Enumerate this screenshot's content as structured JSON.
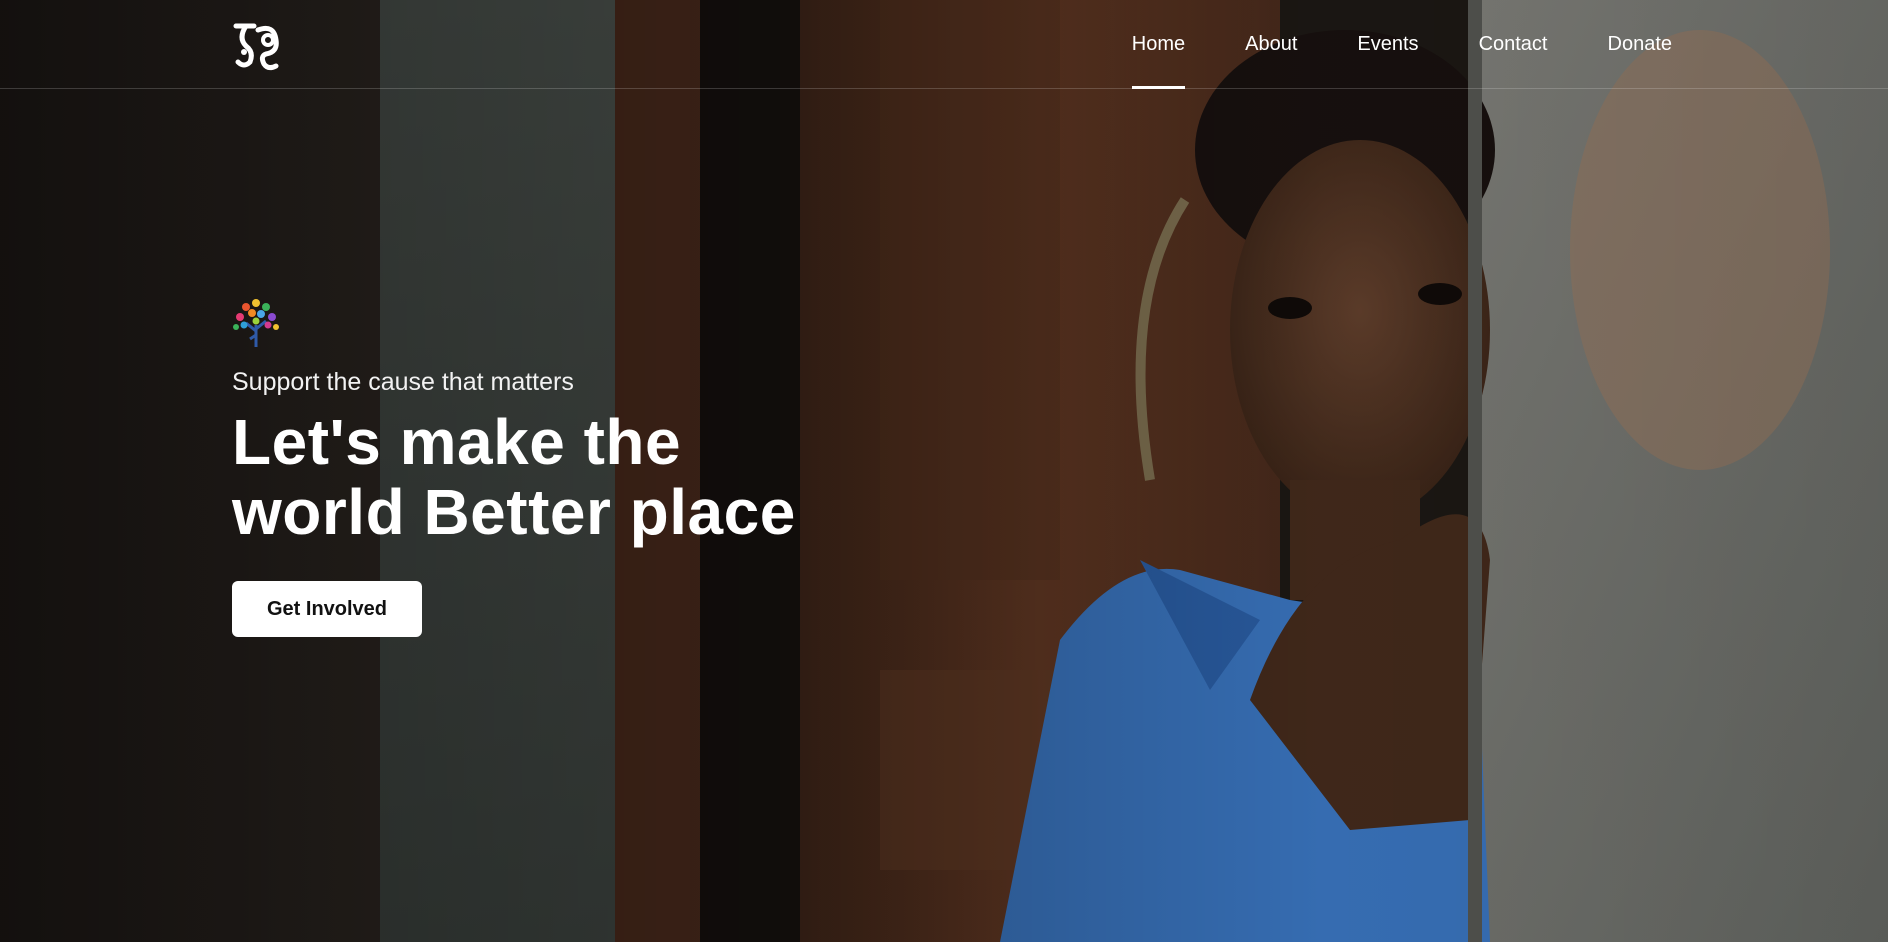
{
  "header": {
    "logo_alt": "রং"
  },
  "nav": {
    "items": [
      {
        "label": "Home",
        "active": true
      },
      {
        "label": "About",
        "active": false
      },
      {
        "label": "Events",
        "active": false
      },
      {
        "label": "Contact",
        "active": false
      },
      {
        "label": "Donate",
        "active": false
      }
    ]
  },
  "hero": {
    "tagline": "Support the cause that matters",
    "headline_line1": "Let's make the",
    "headline_line2": "world Better place",
    "cta_label": "Get Involved"
  },
  "colors": {
    "text": "#ffffff",
    "button_bg": "#ffffff",
    "button_text": "#111111",
    "shirt_blue": "#3f7fd0"
  }
}
